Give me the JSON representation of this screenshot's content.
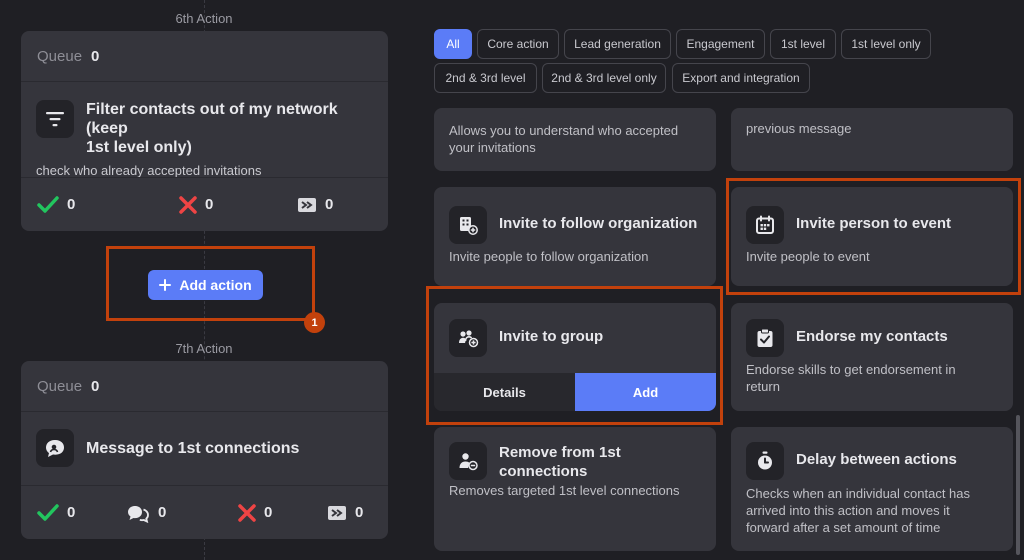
{
  "workflow": {
    "step6_label": "6th Action",
    "step7_label": "7th Action",
    "card6": {
      "queue_label": "Queue",
      "queue_count": "0",
      "title_line1": "Filter contacts out of my network (keep",
      "title_line2": "1st level only)",
      "subtitle": "check who already accepted invitations",
      "stats": {
        "accepted": "0",
        "rejected": "0",
        "skipped": "0"
      }
    },
    "add_action_label": "Add action",
    "badge_number": "1",
    "card7": {
      "queue_label": "Queue",
      "queue_count": "0",
      "title": "Message to 1st connections",
      "stats": {
        "accepted": "0",
        "replied": "0",
        "rejected": "0",
        "skipped": "0"
      }
    }
  },
  "filters": [
    {
      "label": "All",
      "active": true
    },
    {
      "label": "Core action"
    },
    {
      "label": "Lead generation"
    },
    {
      "label": "Engagement"
    },
    {
      "label": "1st level"
    },
    {
      "label": "1st level only"
    },
    {
      "label": "2nd & 3rd level"
    },
    {
      "label": "2nd & 3rd level only"
    },
    {
      "label": "Export and integration"
    }
  ],
  "actions": {
    "partial_left_desc_l1": "Allows you to understand who accepted",
    "partial_left_desc_l2": "your invitations",
    "partial_right_desc": "previous message",
    "follow_org": {
      "title": "Invite to follow organization",
      "desc": "Invite people to follow organization"
    },
    "event": {
      "title": "Invite person to event",
      "desc": "Invite people to event"
    },
    "group": {
      "title": "Invite to group",
      "details_label": "Details",
      "add_label": "Add"
    },
    "endorse": {
      "title": "Endorse my contacts",
      "desc_l1": "Endorse skills to get endorsement in",
      "desc_l2": "return"
    },
    "remove": {
      "title_l1": "Remove from 1st",
      "title_l2": "connections",
      "desc": "Removes targeted 1st level connections"
    },
    "delay": {
      "title": "Delay between actions",
      "desc_l1": "Checks when an individual contact has",
      "desc_l2": "arrived into this action and moves it",
      "desc_l3": "forward after a set amount of time"
    }
  },
  "colors": {
    "accent": "#5b7cf7",
    "highlight": "#c2410c",
    "success": "#22c55e",
    "danger": "#ef4444"
  }
}
